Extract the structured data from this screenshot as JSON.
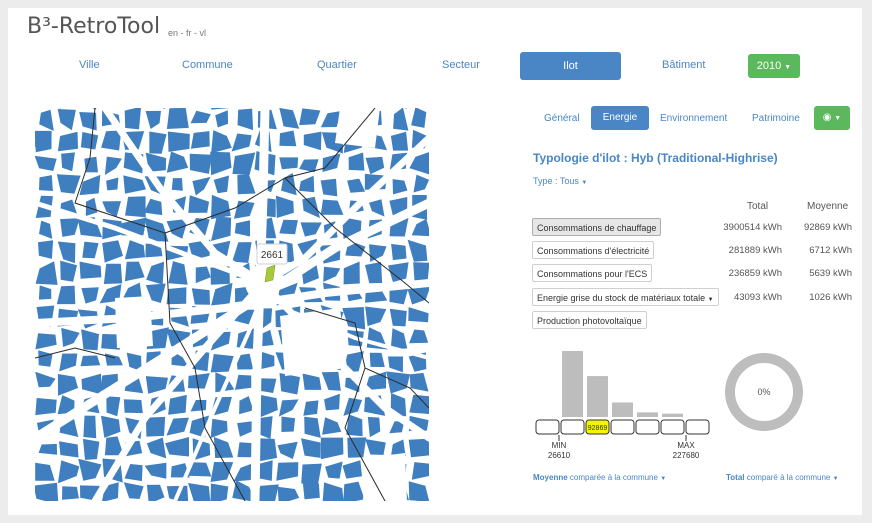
{
  "app": {
    "title": "B³-RetroTool",
    "languages": "en - fr - vl"
  },
  "nav": {
    "items": [
      {
        "label": "Ville"
      },
      {
        "label": "Commune"
      },
      {
        "label": "Quartier"
      },
      {
        "label": "Secteur"
      },
      {
        "label": "Ilot",
        "active": true
      },
      {
        "label": "Bâtiment"
      }
    ],
    "year_label": "2010"
  },
  "map": {
    "tooltip": "2661",
    "colors": {
      "block": "#3f7fbf",
      "street": "#ffffff",
      "selected": "#a5c93a"
    }
  },
  "tabs": {
    "items": [
      {
        "label": "Général"
      },
      {
        "label": "Energie",
        "active": true
      },
      {
        "label": "Environnement"
      },
      {
        "label": "Patrimoine"
      }
    ],
    "eye_icon": "eye-icon"
  },
  "ilot": {
    "typology": "Typologie d'ilot : Hyb (Traditional-Highrise)",
    "type_label": "Type :",
    "type_value": "Tous"
  },
  "table": {
    "col_total": "Total",
    "col_avg": "Moyenne",
    "rows": [
      {
        "label": "Consommations de chauffage",
        "total": "3900514 kWh",
        "avg": "92869 kWh"
      },
      {
        "label": "Consommations d'électricité",
        "total": "281889 kWh",
        "avg": "6712 kWh"
      },
      {
        "label": "Consommations pour l'ECS",
        "total": "236859 kWh",
        "avg": "5639 kWh"
      },
      {
        "label": "Energie grise du stock de matériaux totale",
        "total": "43093 kWh",
        "avg": "1026 kWh"
      },
      {
        "label": "Production photovoltaïque",
        "total": "",
        "avg": ""
      }
    ]
  },
  "histogram": {
    "bins": [
      0,
      1.0,
      0.62,
      0.22,
      0.07,
      0.05,
      0
    ],
    "highlight_value": "92869",
    "min_label": "MIN",
    "min_value": "26610",
    "max_label": "MAX",
    "max_value": "227680",
    "bar_color": "#bdbdbd",
    "highlight_color": "#f5f500"
  },
  "donut": {
    "percent_label": "0%",
    "value": 0,
    "color": "#bdbdbd"
  },
  "legend": {
    "left_bold": "Moyenne",
    "left_rest": "comparée  à la commune",
    "right_bold": "Total",
    "right_rest": "comparé  à la commune"
  }
}
